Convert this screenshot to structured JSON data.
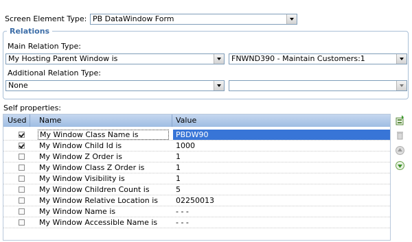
{
  "screen_element": {
    "label": "Screen Element Type:",
    "value": "PB DataWindow Form"
  },
  "relations": {
    "legend": "Relations",
    "main_label": "Main Relation Type:",
    "main_value": "My Hosting Parent Window is",
    "main_target": "FNWND390 - Maintain Customers:1",
    "additional_label": "Additional Relation Type:",
    "additional_value": "None",
    "additional_target": ""
  },
  "self_properties": {
    "label": "Self properties:",
    "columns": {
      "used": "Used",
      "name": "Name",
      "value": "Value"
    },
    "rows": [
      {
        "used": true,
        "name": "My Window Class Name is",
        "value": "PBDW90"
      },
      {
        "used": true,
        "name": "My Window Child Id is",
        "value": "1000"
      },
      {
        "used": false,
        "name": "My Window Z Order is",
        "value": "1"
      },
      {
        "used": false,
        "name": "My Window Class Z Order is",
        "value": "1"
      },
      {
        "used": false,
        "name": "My Window Visibility is",
        "value": "1"
      },
      {
        "used": false,
        "name": "My Window Children Count is",
        "value": "5"
      },
      {
        "used": false,
        "name": "My Window Relative Location is",
        "value": "02250013"
      },
      {
        "used": false,
        "name": "My Window Name is",
        "value": "- - -"
      },
      {
        "used": false,
        "name": "My Window Accessible Name is",
        "value": "- - -"
      }
    ],
    "selected_row": 0
  },
  "side_toolbar": [
    "add-property-icon",
    "delete-icon",
    "move-up-icon",
    "move-down-icon"
  ],
  "colors": {
    "selection": "#3875d7",
    "header": "#b3cbeb",
    "legend": "#3d6ea8"
  }
}
